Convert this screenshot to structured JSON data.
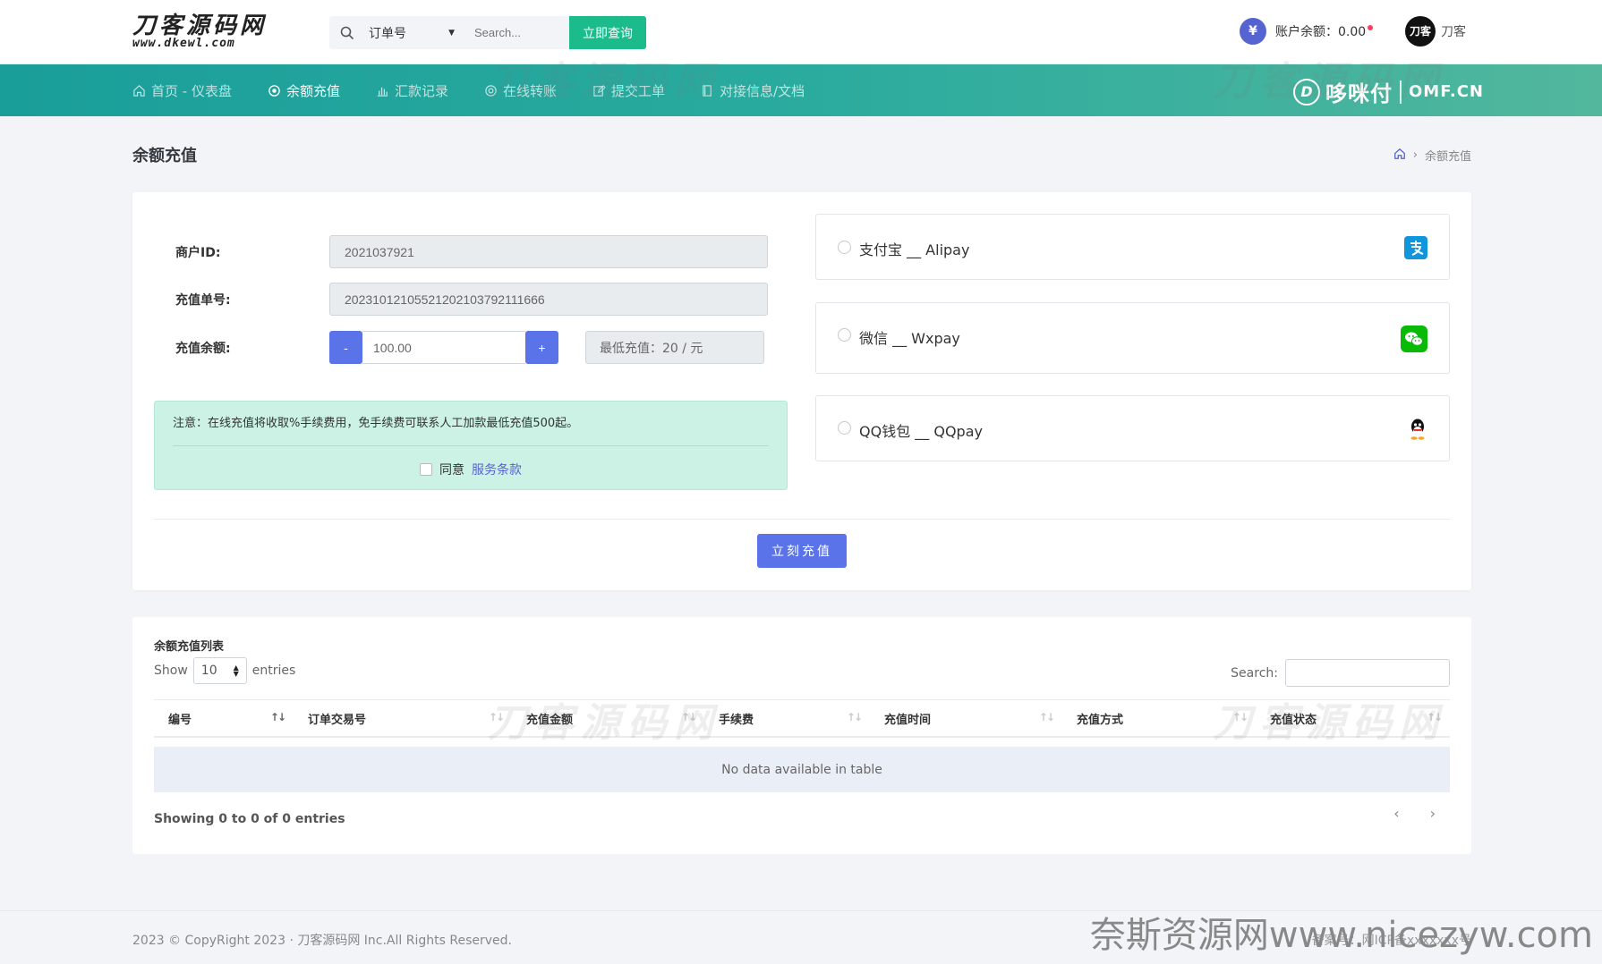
{
  "logo": {
    "main": "刀客源码网",
    "domain": "www.dkewl.com"
  },
  "search": {
    "select_value": "订单号",
    "placeholder": "Search...",
    "button": "立即查询"
  },
  "balance": {
    "icon_text": "¥",
    "label": "账户余额：0.00"
  },
  "user": {
    "avatar_text": "刀客",
    "name": "刀客"
  },
  "nav": [
    {
      "label": "首页 - 仪表盘",
      "icon": "home-icon"
    },
    {
      "label": "余额充值",
      "icon": "target-icon"
    },
    {
      "label": "汇款记录",
      "icon": "bar-chart-icon"
    },
    {
      "label": "在线转账",
      "icon": "transfer-icon"
    },
    {
      "label": "提交工单",
      "icon": "edit-icon"
    },
    {
      "label": "对接信息/文档",
      "icon": "book-icon"
    }
  ],
  "brand": {
    "mark": "D",
    "name": "哆咪付",
    "domain": "OMF.CN"
  },
  "watermark": "刀客源码网",
  "page": {
    "title": "余额充值",
    "breadcrumb_current": "余额充值"
  },
  "form": {
    "merchant_label": "商户ID:",
    "merchant_value": "2021037921",
    "order_label": "充值单号:",
    "order_value": "20231012105521202103792111666",
    "amount_label": "充值余额:",
    "minus": "-",
    "amount_value": "100.00",
    "plus": "+",
    "min_text": "最低充值：20 / 元"
  },
  "notice": {
    "text": "注意：在线充值将收取%手续费用，免手续费可联系人工加款最低充值500起。",
    "agree": "同意",
    "terms": "服务条款"
  },
  "payments": [
    {
      "label": "支付宝 __ Alipay",
      "icon": "alipay-icon",
      "color": "#1296db"
    },
    {
      "label": "微信 __ Wxpay",
      "icon": "wechat-icon",
      "color": "#09bb07"
    },
    {
      "label": "QQ钱包 __ QQpay",
      "icon": "qq-icon",
      "color": "#111111"
    }
  ],
  "submit": "立刻充值",
  "table": {
    "title": "余额充值列表",
    "show": "Show",
    "length": "10",
    "entries": "entries",
    "search_label": "Search:",
    "columns": [
      "编号",
      "订单交易号",
      "充值金额",
      "手续费",
      "充值时间",
      "充值方式",
      "充值状态"
    ],
    "empty": "No data available in table",
    "info": "Showing 0 to 0 of 0 entries",
    "prev": "‹",
    "next": "›"
  },
  "footer": {
    "copyright": "2023 © CopyRight 2023 · 刀客源码网 Inc.All Rights Reserved.",
    "icp": "备案号：网ICP备xxxxxxx号"
  },
  "site_watermark": "奈斯资源网www.nicezyw.com",
  "colors": {
    "primary": "#5b73e8",
    "success": "#1cbb8c",
    "nav_start": "#1a9e9a",
    "nav_end": "#52b79d"
  }
}
